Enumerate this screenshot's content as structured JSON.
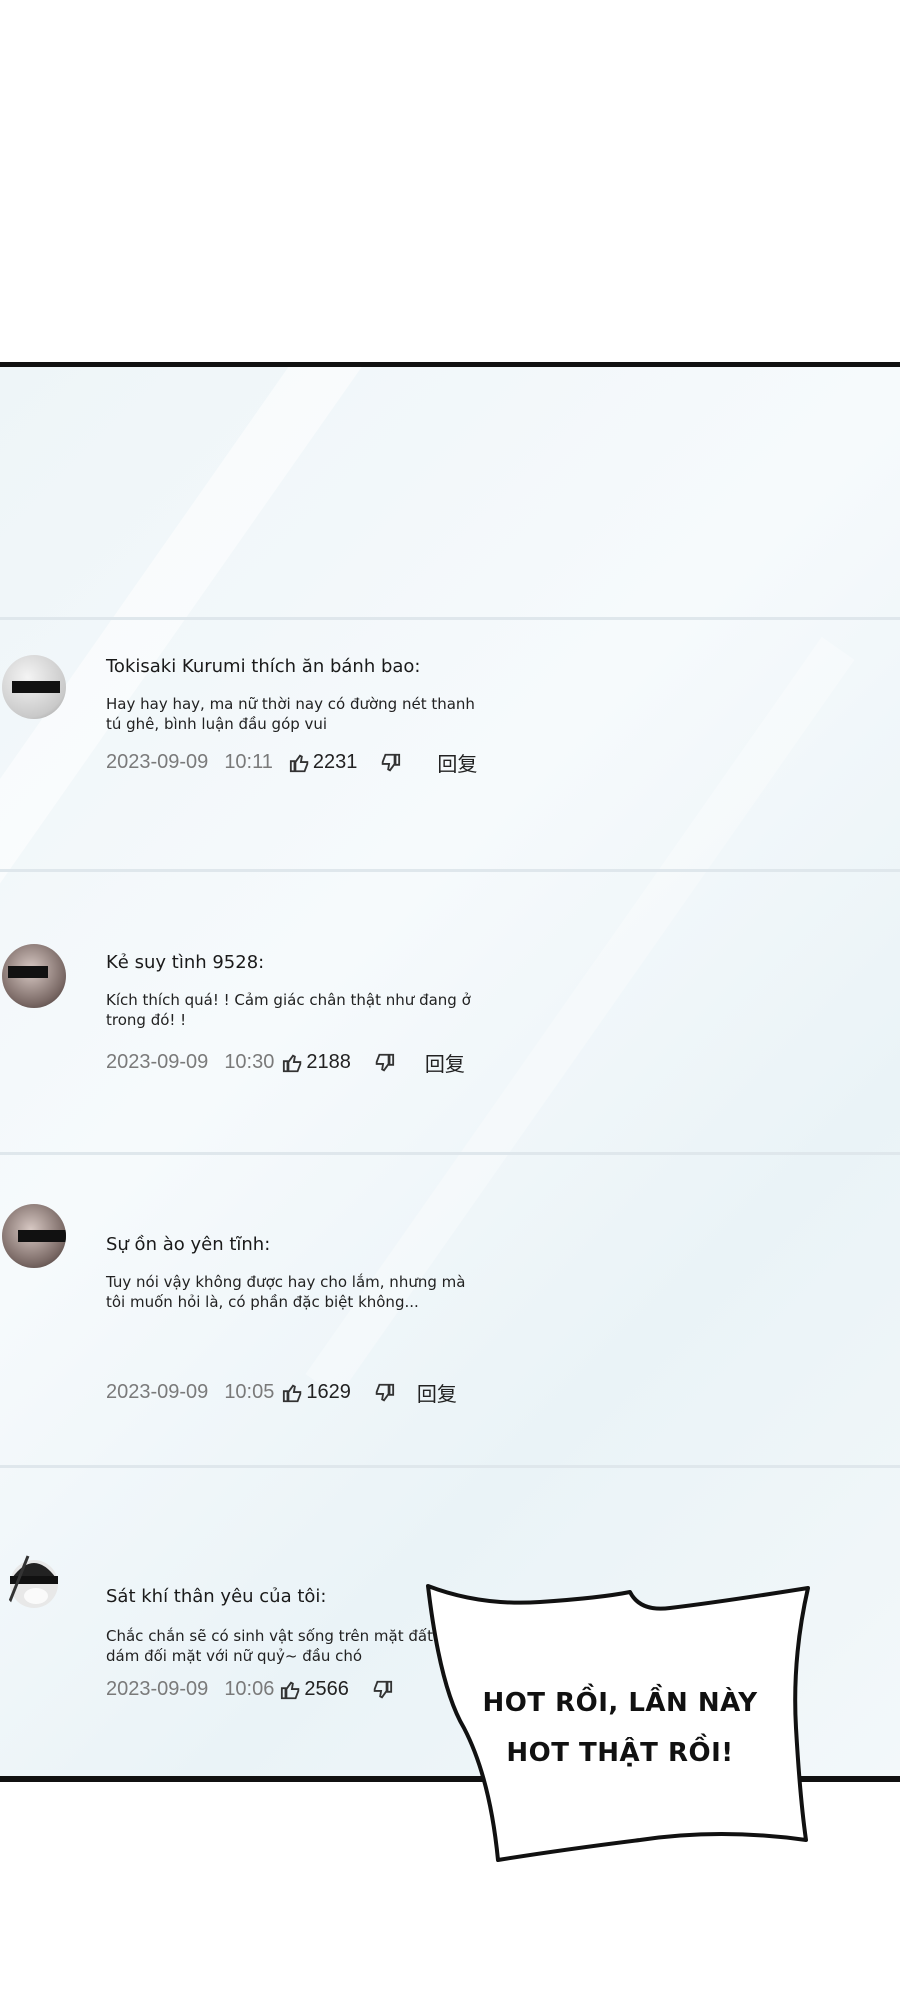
{
  "comments": [
    {
      "user": "Tokisaki Kurumi thích ăn bánh bao:",
      "text": "Hay hay hay, ma nữ thời nay có đường nét thanh tú ghê, bình luận đầu góp vui",
      "date": "2023-09-09",
      "time": "10:11",
      "likes": "2231",
      "reply": "回复"
    },
    {
      "user": "Kẻ suy tình 9528:",
      "text": "Kích thích quá! ! Cảm giác chân thật như đang ở trong đó! !",
      "date": "2023-09-09",
      "time": "10:30",
      "likes": "2188",
      "reply": "回复"
    },
    {
      "user": "Sự ồn ào yên tĩnh:",
      "text": "Tuy nói vậy không được hay cho lắm, nhưng mà tôi muốn hỏi là, có phần đặc biệt không...",
      "date": "2023-09-09",
      "time": "10:05",
      "likes": "1629",
      "reply": "回复"
    },
    {
      "user": "Sát khí thân yêu của tôi:",
      "text": "Chắc chắn sẽ có sinh vật sống trên mặt đất dám đối mặt với nữ quỷ~ đầu chó",
      "date": "2023-09-09",
      "time": "10:06",
      "likes": "2566",
      "reply": ""
    }
  ],
  "speech_bubble": {
    "line1": "HOT RỒI, LẦN NÀY",
    "line2": "HOT THẬT RỒI!"
  },
  "icons": {
    "like": "thumbs-up-icon",
    "dislike": "thumbs-down-icon"
  }
}
